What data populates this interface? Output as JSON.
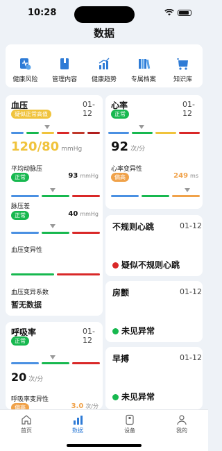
{
  "status": {
    "time": "10:28"
  },
  "page_title": "数据",
  "quick": [
    {
      "label": "健康风险",
      "icon": "health-risk-icon"
    },
    {
      "label": "管理内容",
      "icon": "manage-content-icon"
    },
    {
      "label": "健康趋势",
      "icon": "health-trend-icon"
    },
    {
      "label": "专属档案",
      "icon": "archive-icon"
    },
    {
      "label": "知识库",
      "icon": "knowledge-base-icon"
    }
  ],
  "colors": {
    "accent": "#2e7bd6",
    "normal": "#17b84f",
    "warn": "#f0c33c",
    "risk": "#d92828",
    "orange": "#f0a24a"
  },
  "bp": {
    "title": "血压",
    "date": "01-12",
    "badge": "疑似正常高值",
    "value": "120/80",
    "unit": "mmHg",
    "map": {
      "label": "平均动脉压",
      "badge": "正常",
      "value": "93",
      "unit": "mmHg"
    },
    "pp": {
      "label": "脉压差",
      "badge": "正常",
      "value": "40",
      "unit": "mmHg"
    },
    "bpv": {
      "label": "血压变异性"
    },
    "bpv_coef": {
      "label": "血压变异系数",
      "value": "暂无数据"
    }
  },
  "resp": {
    "title": "呼吸率",
    "date": "01-12",
    "badge": "正常",
    "value": "20",
    "unit": "次/分",
    "var": {
      "label": "呼吸率变异性",
      "badge": "偏高",
      "value": "3.0",
      "unit": "次/分"
    }
  },
  "hr": {
    "title": "心率",
    "date": "01-12",
    "badge": "正常",
    "value": "92",
    "unit": "次/分",
    "hrv": {
      "label": "心率变异性",
      "badge": "偏高",
      "value": "249",
      "unit": "ms"
    }
  },
  "irregular": {
    "title": "不规则心跳",
    "date": "01-12",
    "result": "疑似不规则心跳"
  },
  "af": {
    "title": "房颤",
    "date": "01-12",
    "result": "未见异常"
  },
  "premature": {
    "title": "早搏",
    "date": "01-12",
    "result": "未见异常"
  },
  "tabs": [
    {
      "label": "首页",
      "active": false
    },
    {
      "label": "数据",
      "active": true
    },
    {
      "label": "设备",
      "active": false
    },
    {
      "label": "我的",
      "active": false
    }
  ]
}
